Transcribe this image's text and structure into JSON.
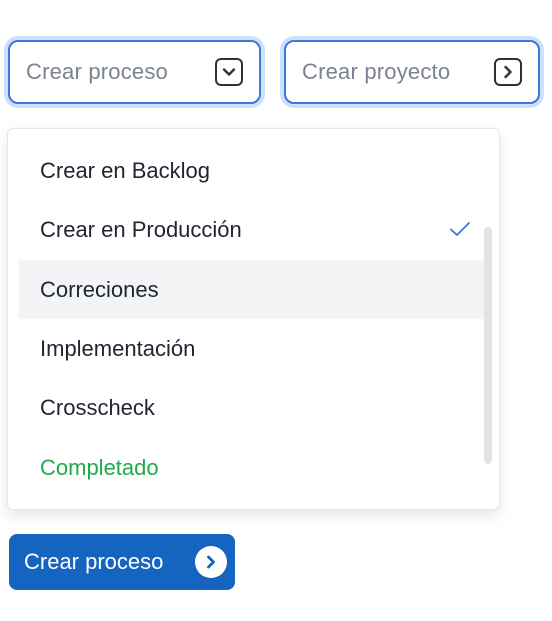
{
  "selects": [
    {
      "placeholder": "Crear proceso",
      "icon": "chevron-down-icon"
    },
    {
      "placeholder": "Crear proyecto",
      "icon": "chevron-right-icon"
    }
  ],
  "dropdown": {
    "options": [
      {
        "label": "Crear en Backlog",
        "selected": false
      },
      {
        "label": "Crear en Producción",
        "selected": true
      },
      {
        "label": "Correciones",
        "highlighted": true
      },
      {
        "label": "Implementación"
      },
      {
        "label": "Crosscheck"
      },
      {
        "label": "Completado",
        "color": "#1faa4e"
      }
    ]
  },
  "button": {
    "label": "Crear proceso",
    "icon": "chevron-right-circle-icon"
  },
  "colors": {
    "accent": "#3a78d8",
    "primary_button": "#1565c0",
    "check": "#3a78d8",
    "completed": "#1faa4e"
  }
}
